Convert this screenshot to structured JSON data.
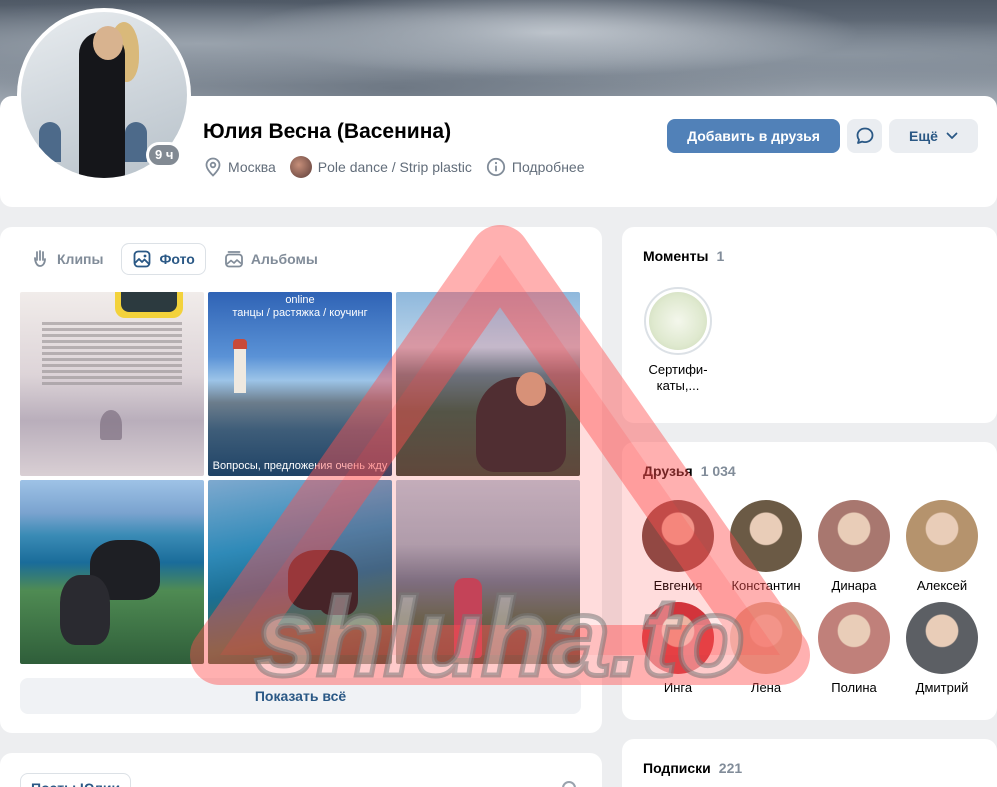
{
  "profile": {
    "name": "Юлия Весна (Васенина)",
    "online_badge": "9 ч",
    "city": "Москва",
    "group": "Pole dance / Strip plastic",
    "details": "Подробнее",
    "add_friend_label": "Добавить в друзья",
    "more_label": "Ещё"
  },
  "photos": {
    "tabs": [
      {
        "label": "Клипы",
        "icon": "clips-icon"
      },
      {
        "label": "Фото",
        "icon": "photo-icon",
        "active": true
      },
      {
        "label": "Альбомы",
        "icon": "albums-icon"
      }
    ],
    "items": [
      {
        "caption_top": "",
        "caption_bottom": ""
      },
      {
        "caption_top": "online\nтанцы / растяжка / коучинг",
        "caption_bottom": "Вопросы, предложения очень жду"
      },
      {
        "caption_top": "",
        "caption_bottom": ""
      },
      {
        "caption_top": "",
        "caption_bottom": ""
      },
      {
        "caption_top": "",
        "caption_bottom": ""
      },
      {
        "caption_top": "",
        "caption_bottom": ""
      }
    ],
    "show_all_label": "Показать всё"
  },
  "posts": {
    "tab_label": "Посты Юлии"
  },
  "moments": {
    "title": "Моменты",
    "count": "1",
    "items": [
      {
        "label": "Сертифи-\nкаты,..."
      }
    ]
  },
  "friends": {
    "title": "Друзья",
    "count": "1 034",
    "items": [
      {
        "name": "Евгения",
        "color": "#7a4b45"
      },
      {
        "name": "Константин",
        "color": "#6b5a45"
      },
      {
        "name": "Динара",
        "color": "#a8776f"
      },
      {
        "name": "Алексей",
        "color": "#b5936d"
      },
      {
        "name": "Инга",
        "color": "#c9323b"
      },
      {
        "name": "Лена",
        "color": "#d9b59a"
      },
      {
        "name": "Полина",
        "color": "#c0807a"
      },
      {
        "name": "Дмитрий",
        "color": "#5c5f64"
      }
    ]
  },
  "subscriptions": {
    "title": "Подписки",
    "count": "221"
  },
  "watermark": {
    "text": "shluha.to"
  },
  "colors": {
    "accent": "#5181b8",
    "link": "#2a5885",
    "secondary_text": "#818c99",
    "background": "#edeef0"
  }
}
